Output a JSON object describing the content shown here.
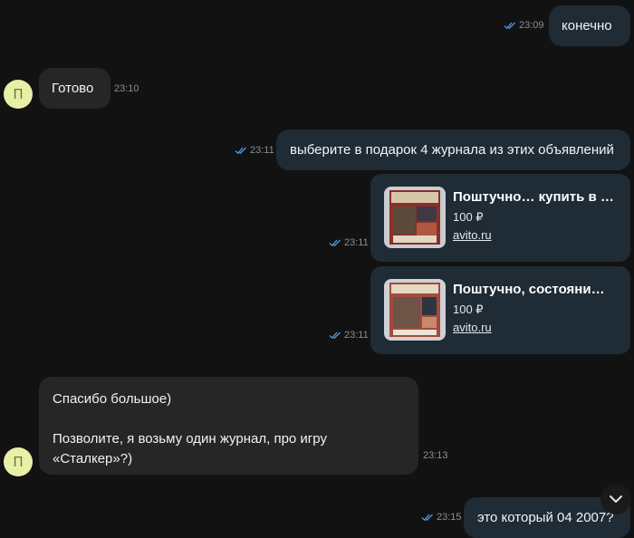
{
  "messages": [
    {
      "text": "конечно",
      "time": "23:09"
    },
    {
      "text": "Готово",
      "time": "23:10",
      "avatar": "П"
    },
    {
      "text": "выберите в подарок 4 журнала из этих объявлений",
      "time": "23:11"
    },
    {
      "title": "Поштучно… купить в …",
      "price": "100 ₽",
      "domain": "avito.ru",
      "time": "23:11"
    },
    {
      "title": "Поштучно, состояни…",
      "price": "100 ₽",
      "domain": "avito.ru",
      "time": "23:11"
    },
    {
      "line1": "Спасибо большое)",
      "line2": "Позволите, я возьму один журнал, про игру",
      "line3": "«Сталкер»?)",
      "time": "23:13",
      "avatar": "П"
    },
    {
      "text": "это который 04 2007?",
      "time": "23:15"
    }
  ],
  "colors": {
    "background": "#121212",
    "outgoing_bubble": "#1f2b35",
    "incoming_bubble": "#262626",
    "read_ticks": "#4f9be0",
    "avatar_bg": "#e8f0a8"
  },
  "icons": {
    "read_receipt": "double-check-icon",
    "scroll_down": "chevron-down-icon"
  }
}
